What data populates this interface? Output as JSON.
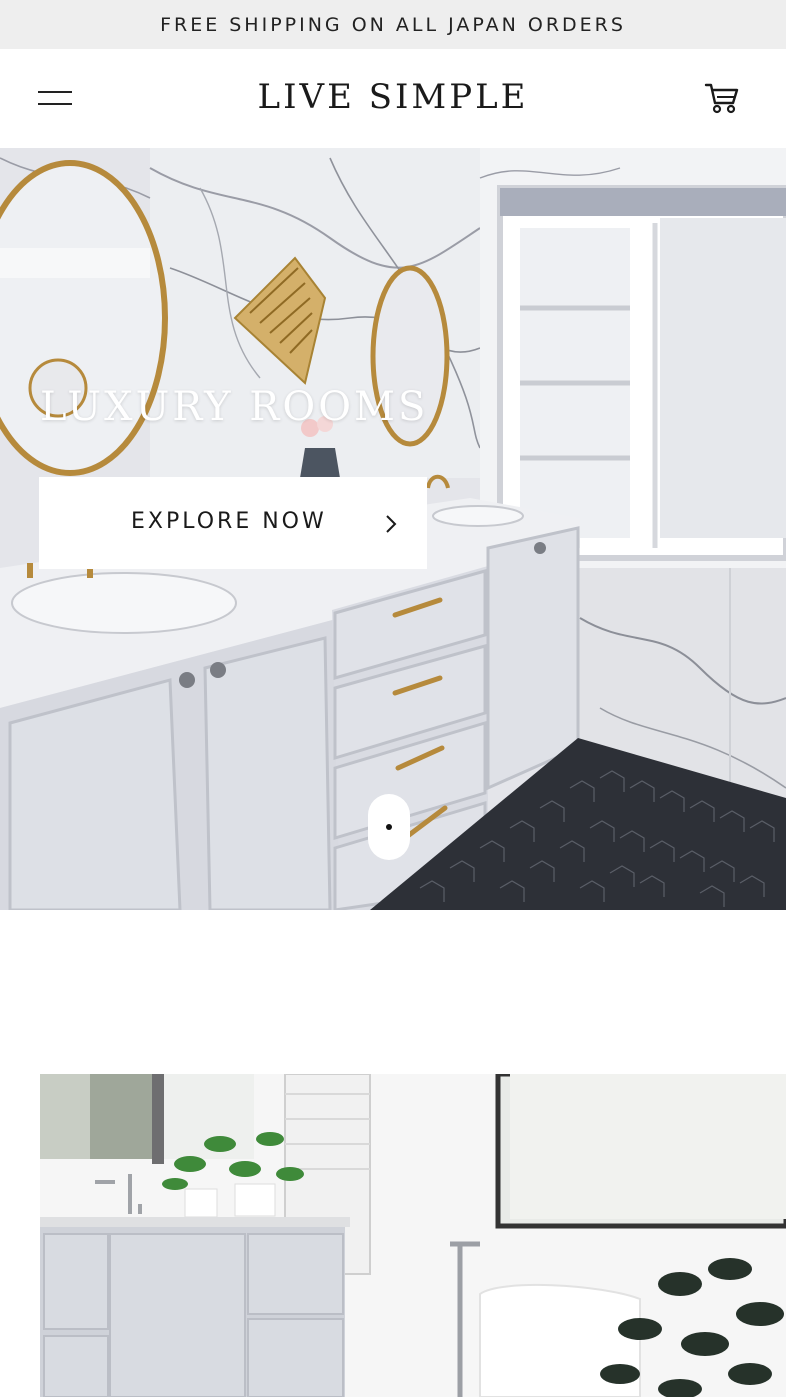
{
  "announcement": {
    "text": "FREE SHIPPING ON ALL JAPAN ORDERS"
  },
  "header": {
    "logo": "LIVE SIMPLE",
    "menu_icon": "hamburger-menu-icon",
    "cart_icon": "shopping-cart-icon"
  },
  "hero": {
    "title": "LUXURY ROOMS",
    "button_label": "EXPLORE NOW",
    "button_icon": "chevron-right-icon",
    "slides_total": 1,
    "active_slide": 1
  },
  "colors": {
    "announcement_bg": "#eeeeee",
    "text": "#1a1a1a",
    "button_bg": "#ffffff"
  }
}
